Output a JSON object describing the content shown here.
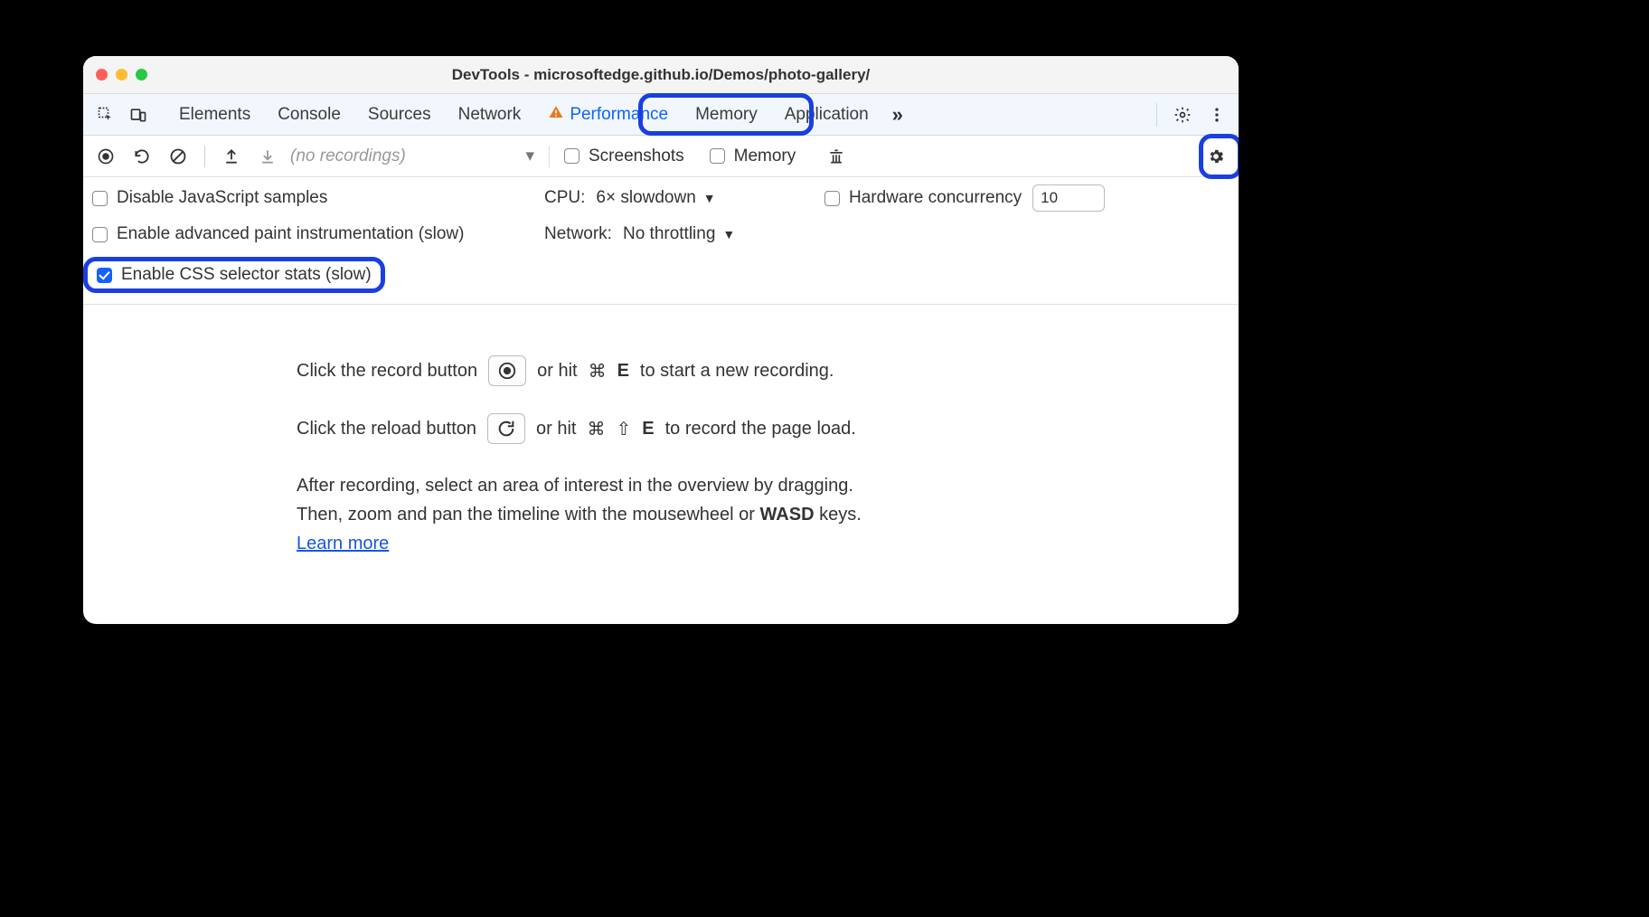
{
  "window": {
    "title": "DevTools - microsoftedge.github.io/Demos/photo-gallery/"
  },
  "tabs": {
    "items": [
      {
        "label": "Elements"
      },
      {
        "label": "Console"
      },
      {
        "label": "Sources"
      },
      {
        "label": "Network"
      },
      {
        "label": "Performance",
        "active": true,
        "warning": true
      },
      {
        "label": "Memory"
      },
      {
        "label": "Application"
      }
    ],
    "more": "»"
  },
  "toolbar": {
    "recordings_placeholder": "(no recordings)",
    "screenshots_label": "Screenshots",
    "memory_label": "Memory"
  },
  "settings": {
    "disable_js_label": "Disable JavaScript samples",
    "cpu_label": "CPU:",
    "cpu_value": "6× slowdown",
    "hc_label": "Hardware concurrency",
    "hc_value": "10",
    "paint_label": "Enable advanced paint instrumentation (slow)",
    "network_label": "Network:",
    "network_value": "No throttling",
    "css_stats_label": "Enable CSS selector stats (slow)"
  },
  "main": {
    "line1_pre": "Click the record button",
    "line1_mid": "or hit",
    "line1_cmd": "⌘",
    "line1_key": "E",
    "line1_post": "to start a new recording.",
    "line2_pre": "Click the reload button",
    "line2_mid": "or hit",
    "line2_cmd": "⌘",
    "line2_shift": "⇧",
    "line2_key": "E",
    "line2_post": "to record the page load.",
    "para1": "After recording, select an area of interest in the overview by dragging. ",
    "para2a": "Then, zoom and pan the timeline with the mousewheel or ",
    "para2b": "WASD",
    "para2c": " keys.",
    "learn_more": "Learn more"
  }
}
